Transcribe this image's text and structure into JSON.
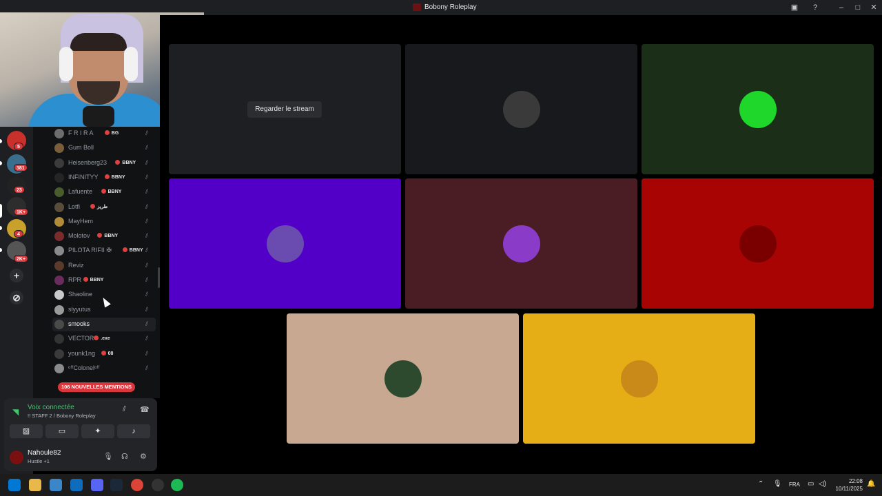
{
  "window": {
    "title": "Bobony Roleplay"
  },
  "servers": [
    {
      "badge": "5",
      "color": "#c9302c"
    },
    {
      "badge": "381",
      "color": "#3b6e8c"
    },
    {
      "badge": "23",
      "color": "#222222"
    },
    {
      "badge": "1K+",
      "color": "#2d2d2d"
    },
    {
      "badge": "4",
      "color": "#c8a02a"
    },
    {
      "badge": "2K+",
      "color": "#555555"
    }
  ],
  "members": [
    {
      "name": "F R I R A",
      "tag": "BG",
      "avatar_color": "#6d6d6d"
    },
    {
      "name": "Gum Boll",
      "tag": "",
      "avatar_color": "#7a5d3a"
    },
    {
      "name": "Heisenberg23",
      "tag": "BBNY",
      "avatar_color": "#3b3b3b"
    },
    {
      "name": "INFINITYY",
      "tag": "BBNY",
      "avatar_color": "#252525"
    },
    {
      "name": "Lafuente",
      "tag": "BBNY",
      "avatar_color": "#4a5c2c"
    },
    {
      "name": "Lotfi",
      "tag": "طريز",
      "avatar_color": "#5a4c3b"
    },
    {
      "name": "MayHem",
      "tag": "",
      "avatar_color": "#b08b3a"
    },
    {
      "name": "Molotov",
      "tag": "BBNY",
      "avatar_color": "#7a2c2c"
    },
    {
      "name": "PILOTA RIFII ✠",
      "tag": "BBNY",
      "avatar_color": "#8a8a8a"
    },
    {
      "name": "Reviz",
      "tag": "",
      "avatar_color": "#5a3a2a"
    },
    {
      "name": "RPR",
      "tag": "BBNY",
      "avatar_color": "#6a2c5c"
    },
    {
      "name": "Shaoline",
      "tag": "",
      "avatar_color": "#c9c9c9"
    },
    {
      "name": "slyyutus",
      "tag": "",
      "avatar_color": "#9a9a9a"
    },
    {
      "name": "smooks",
      "tag": "",
      "avatar_color": "#4a4a4a"
    },
    {
      "name": "VECTOR",
      "tag": ".exe",
      "avatar_color": "#333333"
    },
    {
      "name": "younk1ng",
      "tag": "08",
      "avatar_color": "#3a3a3a"
    },
    {
      "name": "ᵒᶠᶠColonelᵒᶠᶠ",
      "tag": "",
      "avatar_color": "#8a8a8a"
    }
  ],
  "mentions_label": "106 NOUVELLES MENTIONS",
  "voice": {
    "status": "Voix connectée",
    "channel": "!! STAFF 2 / Bobony Roleplay"
  },
  "user": {
    "name": "Nahoule82",
    "status": "Hustle +1"
  },
  "stage": {
    "watch_button": "Regarder le stream",
    "tile_colors": [
      "#1e1f22",
      "#18191c",
      "#1b2e18",
      "#5200c7",
      "#4a1d24",
      "#a80404",
      "#c9a891",
      "#e6ae16"
    ]
  },
  "taskbar": {
    "lang": "FRA",
    "time": "22:08",
    "date": "10/11/2025"
  }
}
